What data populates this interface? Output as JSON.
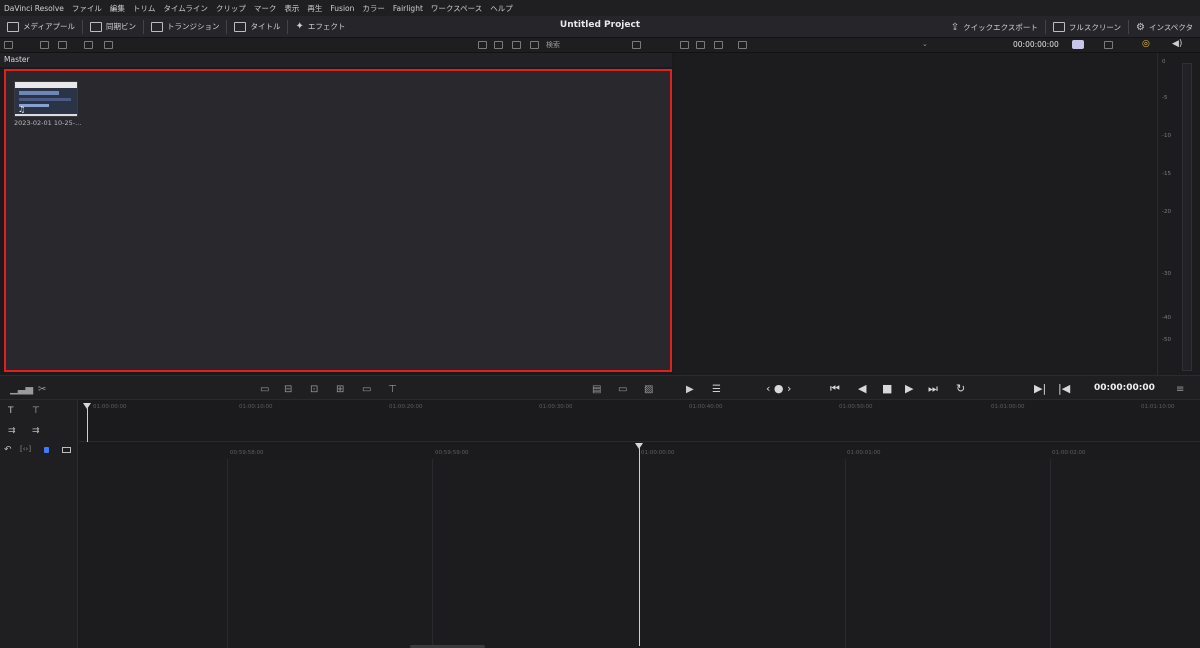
{
  "menubar": {
    "items": [
      "DaVinci Resolve",
      "ファイル",
      "編集",
      "トリム",
      "タイムライン",
      "クリップ",
      "マーク",
      "表示",
      "再生",
      "Fusion",
      "カラー",
      "Fairlight",
      "ワークスペース",
      "ヘルプ"
    ]
  },
  "toolbar": {
    "media_pool": "メディアプール",
    "sync_bin": "同期ビン",
    "transitions": "トランジション",
    "titles": "タイトル",
    "effects": "エフェクト",
    "project_title": "Untitled Project",
    "quick_export": "クイックエクスポート",
    "fullscreen": "フルスクリーン",
    "inspector": "インスペクタ"
  },
  "subbar": {
    "search_label": "検索",
    "viewer_timecode": "00:00:00:00"
  },
  "media_pool": {
    "bin_name": "Master",
    "clips": [
      {
        "label": "2023-02-01 10-25-..."
      }
    ]
  },
  "audio_meter": {
    "labels": [
      "0",
      "-5",
      "-10",
      "-15",
      "-20",
      "-30",
      "-40",
      "-50"
    ]
  },
  "transport": {
    "timecode": "00:00:00:00"
  },
  "timeline": {
    "upper_ruler": [
      "01:00:00:00",
      "01:00:10:00",
      "01:00:20:00",
      "01:00:30:00",
      "01:00:40:00",
      "01:00:50:00",
      "01:01:00:00",
      "01:01:10:00"
    ],
    "lower_ruler": [
      "00:59:58:00",
      "00:59:59:00",
      "01:00:00:00",
      "01:00:01:00",
      "01:00:02:00"
    ]
  }
}
